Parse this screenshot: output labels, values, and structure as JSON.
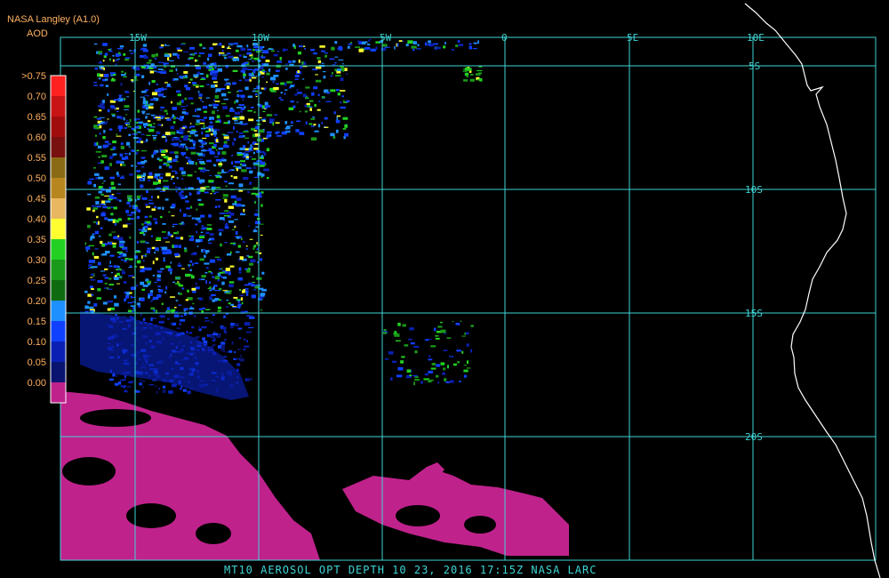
{
  "header": {
    "product_label": "NASA Langley (A1.0)",
    "variable_label": "AOD"
  },
  "legend": {
    "labels": [
      ">0.75",
      "0.70",
      "0.65",
      "0.60",
      "0.55",
      "0.50",
      "0.45",
      "0.40",
      "0.35",
      "0.30",
      "0.25",
      "0.20",
      "0.15",
      "0.10",
      "0.05",
      "0.00"
    ],
    "colors": [
      "#ff2020",
      "#c81414",
      "#a00c0c",
      "#781010",
      "#8a6a14",
      "#b8861e",
      "#e8b860",
      "#ffff30",
      "#22d022",
      "#1a9a1a",
      "#0f6b0f",
      "#1e90ff",
      "#1040ff",
      "#0a20b4",
      "#081470",
      "#c0228c"
    ]
  },
  "grid": {
    "longitude_labels": [
      "15W",
      "10W",
      "5W",
      "0",
      "5E",
      "10E"
    ],
    "latitude_labels": [
      "5S",
      "10S",
      "15S",
      "20S"
    ]
  },
  "caption": "MT10  AEROSOL OPT DEPTH   10 23, 2016 17:15Z   NASA LARC",
  "colors": {
    "grid": "#3fd4d4",
    "coast": "#ffffff",
    "low_aod": "#c0228c",
    "background": "#000000"
  }
}
